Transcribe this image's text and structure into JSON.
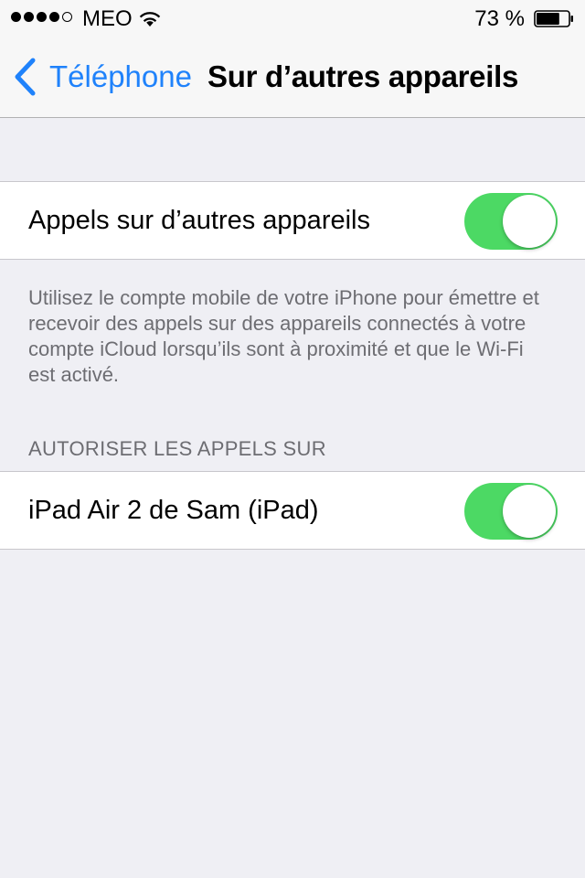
{
  "status_bar": {
    "signal_dots_filled": 4,
    "signal_dots_total": 5,
    "carrier": "MEO",
    "wifi_icon": "wifi-icon",
    "battery_percent": "73 %",
    "battery_level": 0.73
  },
  "nav": {
    "back_label": "Téléphone",
    "title": "Sur d’autres appareils"
  },
  "main_toggle": {
    "label": "Appels sur d’autres appareils",
    "on": true
  },
  "description": "Utilisez le compte mobile de votre iPhone pour émettre et recevoir des appels sur des appareils connectés à votre compte iCloud lorsqu’ils sont à proximité et que le Wi-Fi est activé.",
  "devices_section": {
    "header": "AUTORISER LES APPELS SUR",
    "items": [
      {
        "label": "iPad Air 2 de Sam (iPad)",
        "on": true
      }
    ]
  },
  "colors": {
    "accent": "#1f82fb",
    "toggle_on": "#4cd964",
    "background": "#efeff4"
  }
}
